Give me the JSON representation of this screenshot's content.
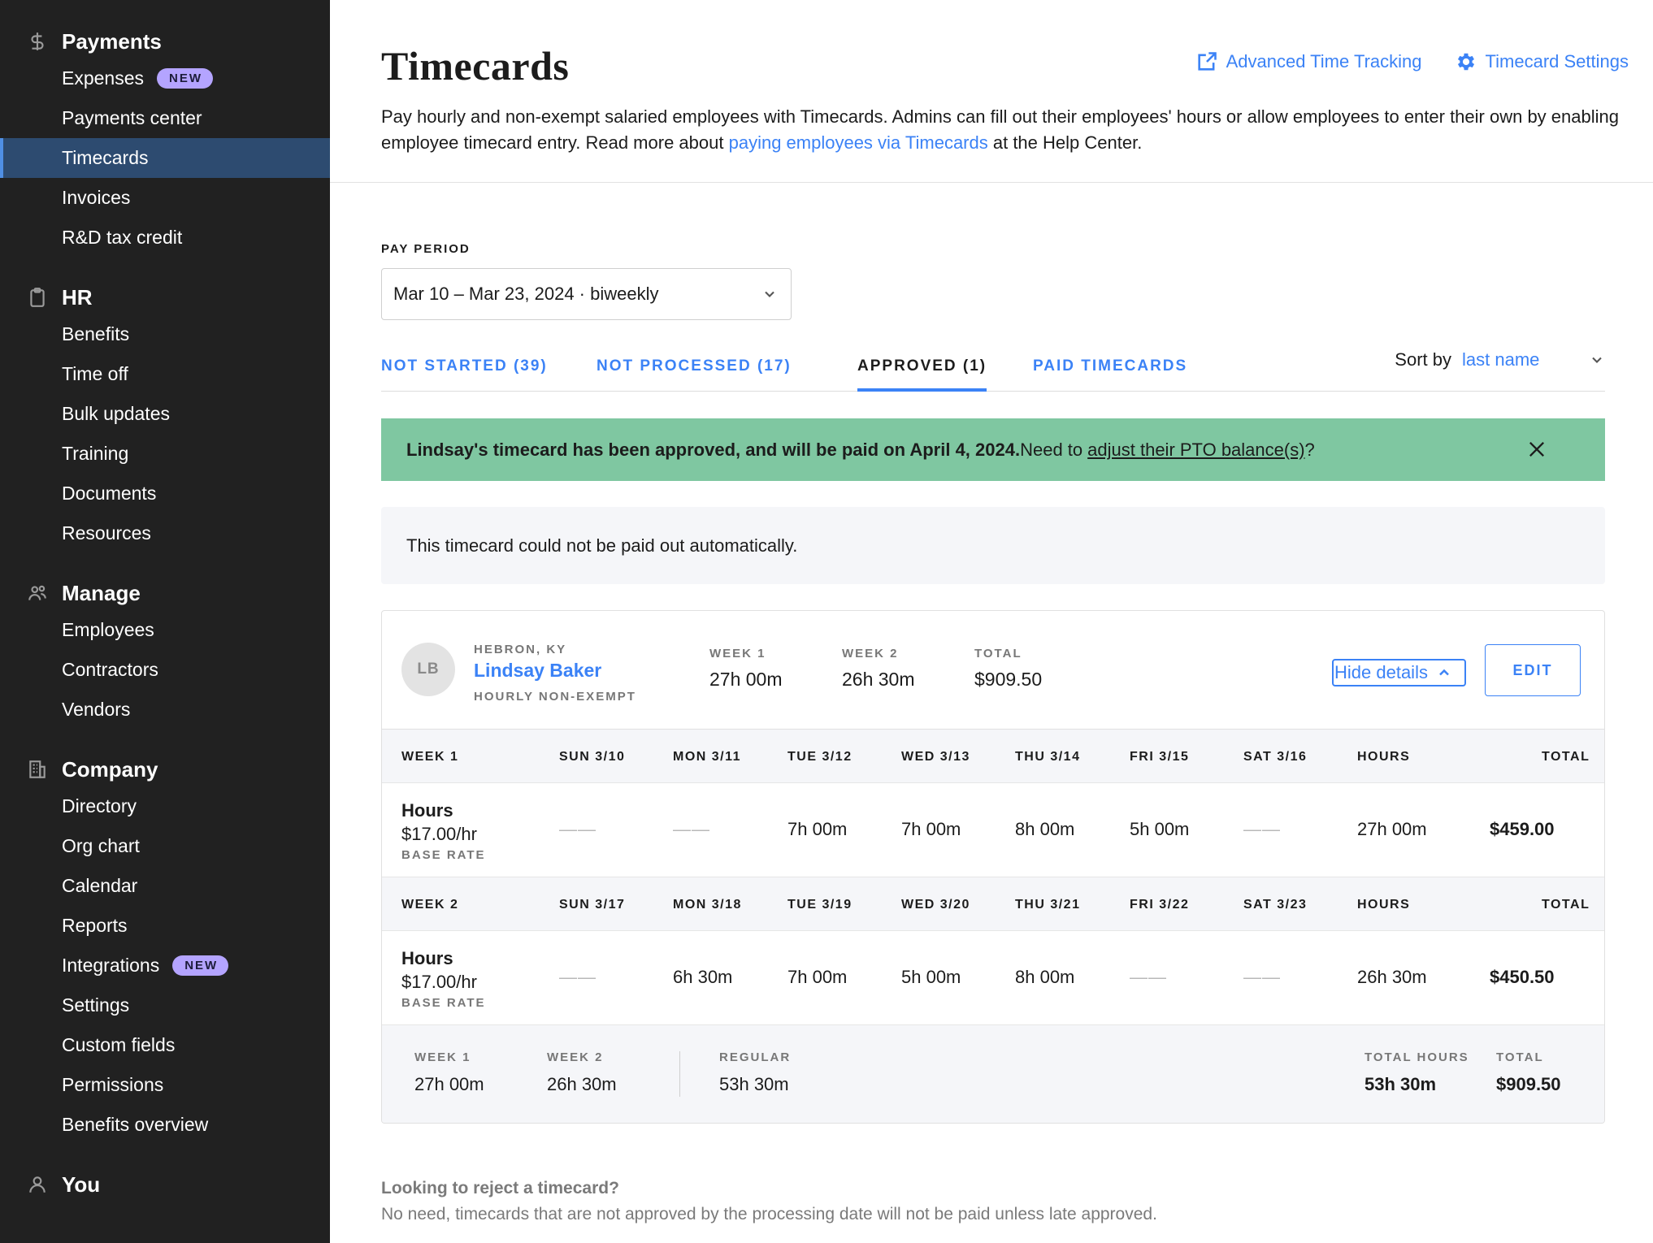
{
  "sidebar": {
    "payments": {
      "title": "Payments",
      "items": [
        {
          "label": "Expenses",
          "badge": "NEW"
        },
        {
          "label": "Payments center"
        },
        {
          "label": "Timecards",
          "active": true
        },
        {
          "label": "Invoices"
        },
        {
          "label": "R&D tax credit"
        }
      ]
    },
    "hr": {
      "title": "HR",
      "items": [
        {
          "label": "Benefits"
        },
        {
          "label": "Time off"
        },
        {
          "label": "Bulk updates"
        },
        {
          "label": "Training"
        },
        {
          "label": "Documents"
        },
        {
          "label": "Resources"
        }
      ]
    },
    "manage": {
      "title": "Manage",
      "items": [
        {
          "label": "Employees"
        },
        {
          "label": "Contractors"
        },
        {
          "label": "Vendors"
        }
      ]
    },
    "company": {
      "title": "Company",
      "items": [
        {
          "label": "Directory"
        },
        {
          "label": "Org chart"
        },
        {
          "label": "Calendar"
        },
        {
          "label": "Reports"
        },
        {
          "label": "Integrations",
          "badge": "NEW"
        },
        {
          "label": "Settings"
        },
        {
          "label": "Custom fields"
        },
        {
          "label": "Permissions"
        },
        {
          "label": "Benefits overview"
        }
      ]
    },
    "you": {
      "title": "You"
    }
  },
  "header": {
    "title": "Timecards",
    "advanced_link": "Advanced Time Tracking",
    "settings_link": "Timecard Settings",
    "intro_text_1": "Pay hourly and non-exempt salaried employees with Timecards. Admins can fill out their employees' hours or allow employees to enter their own by enabling employee timecard entry. Read more about ",
    "intro_link": "paying employees via Timecards",
    "intro_text_2": " at the Help Center."
  },
  "pay_period": {
    "label": "PAY PERIOD",
    "value": "Mar 10 – Mar 23, 2024 · biweekly"
  },
  "tabs": [
    {
      "label": "NOT STARTED (39)"
    },
    {
      "label": "NOT PROCESSED (17)"
    },
    {
      "label": "APPROVED (1)",
      "active": true
    },
    {
      "label": "PAID TIMECARDS"
    }
  ],
  "sort": {
    "label": "Sort by",
    "value": "last name"
  },
  "alert": {
    "bold_text": "Lindsay's timecard has been approved, and will be paid on April 4, 2024.",
    "text": " Need to",
    "link": "adjust their PTO balance(s)",
    "suffix": "?"
  },
  "notice": "This timecard could not be paid out automatically.",
  "employee": {
    "initials": "LB",
    "location": "HEBRON, KY",
    "name": "Lindsay Baker",
    "type": "HOURLY NON-EXEMPT",
    "summary": [
      {
        "label": "WEEK 1",
        "value": "27h 00m"
      },
      {
        "label": "WEEK 2",
        "value": "26h 30m"
      },
      {
        "label": "TOTAL",
        "value": "$909.50"
      }
    ],
    "hide_details": "Hide details",
    "edit": "EDIT"
  },
  "weeks": [
    {
      "label": "WEEK 1",
      "days": [
        "SUN 3/10",
        "MON 3/11",
        "TUE 3/12",
        "WED 3/13",
        "THU 3/14",
        "FRI 3/15",
        "SAT 3/16"
      ],
      "hours_label": "HOURS",
      "total_label": "TOTAL",
      "row_title": "Hours",
      "rate": "$17.00/hr",
      "rate_label": "BASE RATE",
      "values": [
        "——",
        "——",
        "7h 00m",
        "7h 00m",
        "8h 00m",
        "5h 00m",
        "——"
      ],
      "hours": "27h 00m",
      "total": "$459.00"
    },
    {
      "label": "WEEK 2",
      "days": [
        "SUN 3/17",
        "MON 3/18",
        "TUE 3/19",
        "WED 3/20",
        "THU 3/21",
        "FRI 3/22",
        "SAT 3/23"
      ],
      "hours_label": "HOURS",
      "total_label": "TOTAL",
      "row_title": "Hours",
      "rate": "$17.00/hr",
      "rate_label": "BASE RATE",
      "values": [
        "——",
        "6h 30m",
        "7h 00m",
        "5h 00m",
        "8h 00m",
        "——",
        "——"
      ],
      "hours": "26h 30m",
      "total": "$450.50"
    }
  ],
  "footer": {
    "week1_label": "WEEK 1",
    "week1": "27h 00m",
    "week2_label": "WEEK 2",
    "week2": "26h 30m",
    "regular_label": "REGULAR",
    "regular": "53h 30m",
    "total_hours_label": "TOTAL HOURS",
    "total_hours": "53h 30m",
    "total_label": "TOTAL",
    "total": "$909.50"
  },
  "reject": {
    "question": "Looking to reject a timecard?",
    "answer": "No need, timecards that are not approved by the processing date will not be paid unless late approved."
  },
  "colors": {
    "accent": "#3b82f6",
    "sidebar_bg": "#212121",
    "active_nav": "#2d4b70",
    "alert_bg": "#7fc7a1",
    "badge": "#b4a4ff"
  }
}
